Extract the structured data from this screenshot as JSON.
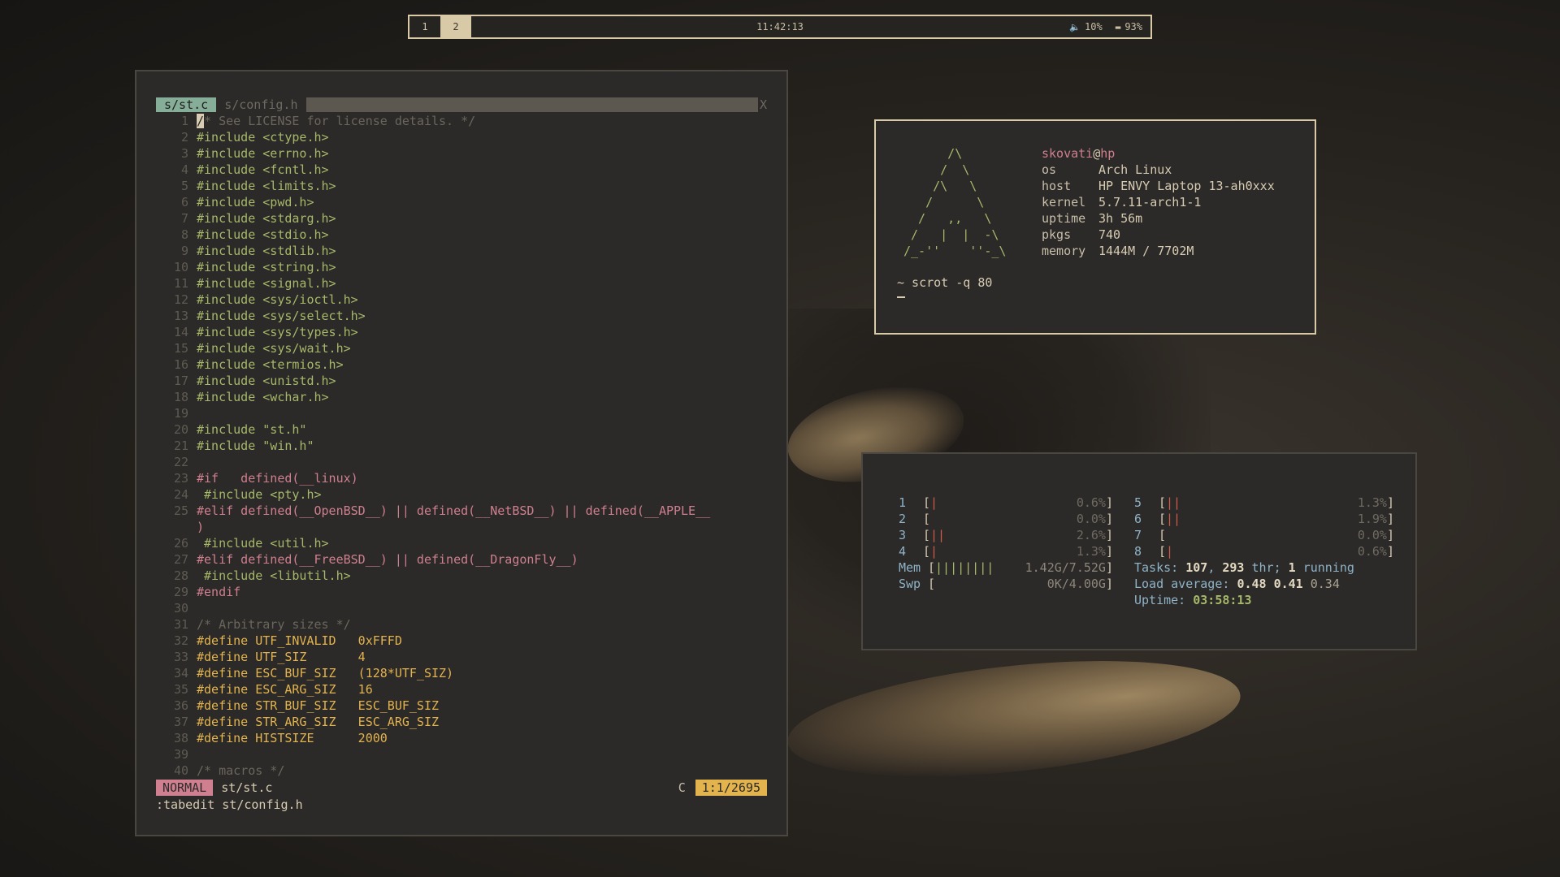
{
  "topbar": {
    "workspaces": [
      "1",
      "2"
    ],
    "active_workspace": "2",
    "clock": "11:42:13",
    "volume": "10%",
    "battery": "93%"
  },
  "vim": {
    "tabs": {
      "active": "s/st.c",
      "inactive": "s/config.h",
      "close": "X"
    },
    "lines": [
      {
        "n": "1",
        "t": "/* See LICENSE for license details. */",
        "c": "c-cmt"
      },
      {
        "n": "2",
        "t": "#include <ctype.h>",
        "c": "c-inc"
      },
      {
        "n": "3",
        "t": "#include <errno.h>",
        "c": "c-inc"
      },
      {
        "n": "4",
        "t": "#include <fcntl.h>",
        "c": "c-inc"
      },
      {
        "n": "5",
        "t": "#include <limits.h>",
        "c": "c-inc"
      },
      {
        "n": "6",
        "t": "#include <pwd.h>",
        "c": "c-inc"
      },
      {
        "n": "7",
        "t": "#include <stdarg.h>",
        "c": "c-inc"
      },
      {
        "n": "8",
        "t": "#include <stdio.h>",
        "c": "c-inc"
      },
      {
        "n": "9",
        "t": "#include <stdlib.h>",
        "c": "c-inc"
      },
      {
        "n": "10",
        "t": "#include <string.h>",
        "c": "c-inc"
      },
      {
        "n": "11",
        "t": "#include <signal.h>",
        "c": "c-inc"
      },
      {
        "n": "12",
        "t": "#include <sys/ioctl.h>",
        "c": "c-inc"
      },
      {
        "n": "13",
        "t": "#include <sys/select.h>",
        "c": "c-inc"
      },
      {
        "n": "14",
        "t": "#include <sys/types.h>",
        "c": "c-inc"
      },
      {
        "n": "15",
        "t": "#include <sys/wait.h>",
        "c": "c-inc"
      },
      {
        "n": "16",
        "t": "#include <termios.h>",
        "c": "c-inc"
      },
      {
        "n": "17",
        "t": "#include <unistd.h>",
        "c": "c-inc"
      },
      {
        "n": "18",
        "t": "#include <wchar.h>",
        "c": "c-inc"
      },
      {
        "n": "19",
        "t": "",
        "c": ""
      },
      {
        "n": "20",
        "t": "#include \"st.h\"",
        "c": "c-inc"
      },
      {
        "n": "21",
        "t": "#include \"win.h\"",
        "c": "c-inc"
      },
      {
        "n": "22",
        "t": "",
        "c": ""
      },
      {
        "n": "23",
        "t": "#if   defined(__linux)",
        "c": "c-pre"
      },
      {
        "n": "24",
        "t": " #include <pty.h>",
        "c": "c-inc"
      },
      {
        "n": "25",
        "t": "#elif defined(__OpenBSD__) || defined(__NetBSD__) || defined(__APPLE__",
        "c": "c-pre"
      },
      {
        "n": "",
        "t": ")",
        "c": "c-pre"
      },
      {
        "n": "26",
        "t": " #include <util.h>",
        "c": "c-inc"
      },
      {
        "n": "27",
        "t": "#elif defined(__FreeBSD__) || defined(__DragonFly__)",
        "c": "c-pre"
      },
      {
        "n": "28",
        "t": " #include <libutil.h>",
        "c": "c-inc"
      },
      {
        "n": "29",
        "t": "#endif",
        "c": "c-pre"
      },
      {
        "n": "30",
        "t": "",
        "c": ""
      },
      {
        "n": "31",
        "t": "/* Arbitrary sizes */",
        "c": "c-cmt"
      },
      {
        "n": "32",
        "t": "#define UTF_INVALID   0xFFFD",
        "c": "c-def"
      },
      {
        "n": "33",
        "t": "#define UTF_SIZ       4",
        "c": "c-def"
      },
      {
        "n": "34",
        "t": "#define ESC_BUF_SIZ   (128*UTF_SIZ)",
        "c": "c-def"
      },
      {
        "n": "35",
        "t": "#define ESC_ARG_SIZ   16",
        "c": "c-def"
      },
      {
        "n": "36",
        "t": "#define STR_BUF_SIZ   ESC_BUF_SIZ",
        "c": "c-def"
      },
      {
        "n": "37",
        "t": "#define STR_ARG_SIZ   ESC_ARG_SIZ",
        "c": "c-def"
      },
      {
        "n": "38",
        "t": "#define HISTSIZE      2000",
        "c": "c-def"
      },
      {
        "n": "39",
        "t": "",
        "c": ""
      },
      {
        "n": "40",
        "t": "/* macros */",
        "c": "c-cmt"
      }
    ],
    "status": {
      "mode": "NORMAL",
      "file": "st/st.c",
      "filetype": "C",
      "position": "1:1/2695"
    },
    "cmdline": ":tabedit st/config.h"
  },
  "fetch": {
    "ascii": "      /\\\n     /  \\\n    /\\   \\\n   /      \\\n  /   ,,   \\\n /   |  |  -\\\n/_-''    ''-_\\",
    "user": "skovati",
    "at": "@",
    "hostname": "hp",
    "rows": [
      {
        "k": "os",
        "v": "Arch Linux"
      },
      {
        "k": "host",
        "v": "HP ENVY Laptop 13-ah0xxx"
      },
      {
        "k": "kernel",
        "v": "5.7.11-arch1-1"
      },
      {
        "k": "uptime",
        "v": "3h 56m"
      },
      {
        "k": "pkgs",
        "v": "740"
      },
      {
        "k": "memory",
        "v": "1444M / 7702M"
      }
    ],
    "prompt": "~ scrot -q 80"
  },
  "htop": {
    "cpus_left": [
      {
        "label": "1",
        "bar": "|",
        "value": "0.6%"
      },
      {
        "label": "2",
        "bar": "",
        "value": "0.0%"
      },
      {
        "label": "3",
        "bar": "||",
        "value": "2.6%"
      },
      {
        "label": "4",
        "bar": "|",
        "value": "1.3%"
      }
    ],
    "cpus_right": [
      {
        "label": "5",
        "bar": "||",
        "value": "1.3%"
      },
      {
        "label": "6",
        "bar": "||",
        "value": "1.9%"
      },
      {
        "label": "7",
        "bar": "",
        "value": "0.0%"
      },
      {
        "label": "8",
        "bar": "|",
        "value": "0.6%"
      }
    ],
    "mem": {
      "label": "Mem",
      "bar": "||||||||",
      "value": "1.42G/7.52G"
    },
    "swp": {
      "label": "Swp",
      "bar": "",
      "value": "0K/4.00G"
    },
    "tasks": {
      "label": "Tasks:",
      "count": "107",
      "sep": ",",
      "threads": "293",
      "thr_label": "thr;",
      "running": "1",
      "running_label": "running"
    },
    "load": {
      "label": "Load average:",
      "v1": "0.48",
      "v2": "0.41",
      "v3": "0.34"
    },
    "uptime": {
      "label": "Uptime:",
      "value": "03:58:13"
    }
  }
}
